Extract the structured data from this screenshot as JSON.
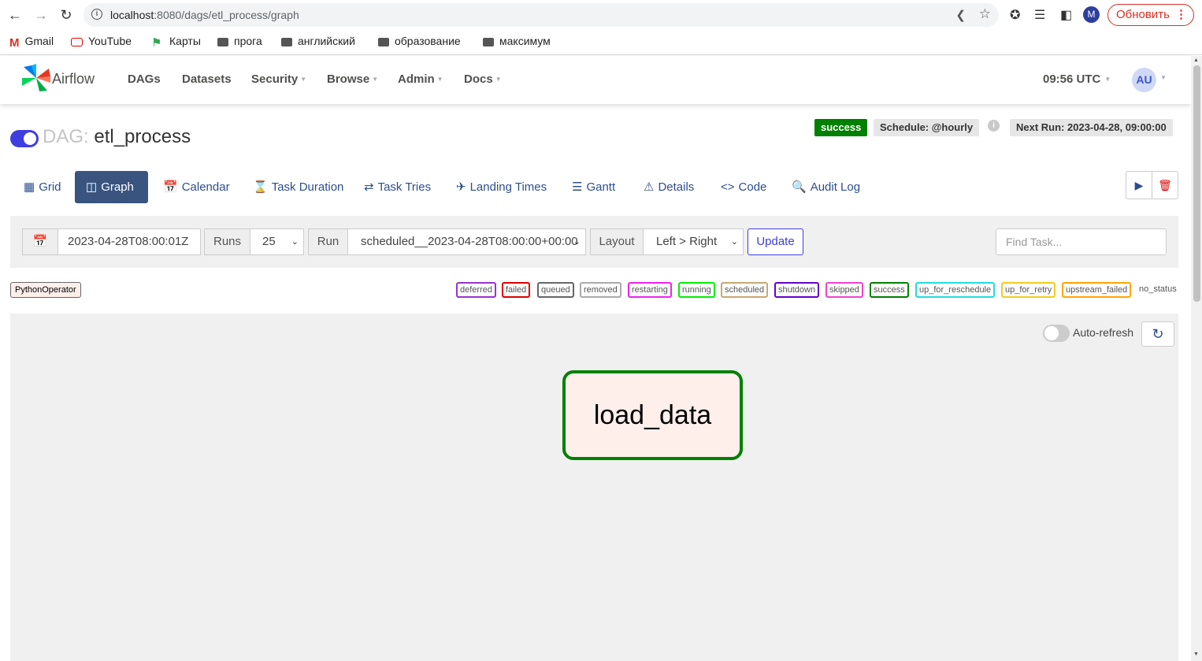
{
  "browser": {
    "url_host": "localhost",
    "url_rest": ":8080/dags/etl_process/graph",
    "profile_initial": "M",
    "update_label": "Обновить",
    "bookmarks": [
      {
        "label": "Gmail",
        "icon": "gmail-icon"
      },
      {
        "label": "YouTube",
        "icon": "youtube-icon"
      },
      {
        "label": "Карты",
        "icon": "maps-icon"
      },
      {
        "label": "прога",
        "icon": "folder-icon"
      },
      {
        "label": "английский",
        "icon": "folder-icon"
      },
      {
        "label": "образование",
        "icon": "folder-icon"
      },
      {
        "label": "максимум",
        "icon": "folder-icon"
      }
    ]
  },
  "navbar": {
    "brand": "Airflow",
    "menu": [
      "DAGs",
      "Datasets",
      "Security",
      "Browse",
      "Admin",
      "Docs"
    ],
    "time": "09:56 UTC",
    "user_initials": "AU"
  },
  "dag": {
    "prefix": "DAG:",
    "name": "etl_process",
    "paused": false,
    "status": "success",
    "schedule": "Schedule: @hourly",
    "next_run": "Next Run: 2023-04-28, 09:00:00"
  },
  "tabs": [
    {
      "label": "Grid",
      "icon": "grid-icon",
      "active": false
    },
    {
      "label": "Graph",
      "icon": "graph-icon",
      "active": true
    },
    {
      "label": "Calendar",
      "icon": "calendar-icon",
      "active": false
    },
    {
      "label": "Task Duration",
      "icon": "hourglass-icon",
      "active": false
    },
    {
      "label": "Task Tries",
      "icon": "retry-icon",
      "active": false
    },
    {
      "label": "Landing Times",
      "icon": "landing-icon",
      "active": false
    },
    {
      "label": "Gantt",
      "icon": "gantt-icon",
      "active": false
    },
    {
      "label": "Details",
      "icon": "warning-triangle-icon",
      "active": false
    },
    {
      "label": "Code",
      "icon": "code-icon",
      "active": false
    },
    {
      "label": "Audit Log",
      "icon": "audit-icon",
      "active": false
    }
  ],
  "filters": {
    "base_date": "2023-04-28T08:00:01Z",
    "runs_label": "Runs",
    "runs_value": "25",
    "run_label": "Run",
    "run_value": "scheduled__2023-04-28T08:00:00+00:00",
    "layout_label": "Layout",
    "layout_value": "Left > Right",
    "update_label": "Update",
    "find_placeholder": "Find Task..."
  },
  "legend": {
    "operator": "PythonOperator",
    "states": [
      {
        "label": "deferred",
        "color": "#9933cc"
      },
      {
        "label": "failed",
        "color": "#dd0000"
      },
      {
        "label": "queued",
        "color": "#666666"
      },
      {
        "label": "removed",
        "color": "#aaaaaa"
      },
      {
        "label": "restarting",
        "color": "#ee22ee"
      },
      {
        "label": "running",
        "color": "#00ee00"
      },
      {
        "label": "scheduled",
        "color": "#c8a870"
      },
      {
        "label": "shutdown",
        "color": "#6600cc"
      },
      {
        "label": "skipped",
        "color": "#ee44cc"
      },
      {
        "label": "success",
        "color": "#008000"
      },
      {
        "label": "up_for_reschedule",
        "color": "#22dddd"
      },
      {
        "label": "up_for_retry",
        "color": "#eecc22"
      },
      {
        "label": "upstream_failed",
        "color": "#ffa500"
      }
    ],
    "no_status": "no_status"
  },
  "graph": {
    "auto_refresh_label": "Auto-refresh",
    "auto_refresh_on": false,
    "tasks": [
      {
        "task_id": "load_data",
        "state": "success",
        "operator": "PythonOperator"
      }
    ]
  },
  "colors": {
    "accent": "#3f3ee1",
    "tab_active": "#38547f",
    "success": "#008000",
    "node_fill": "#ffefeb"
  }
}
